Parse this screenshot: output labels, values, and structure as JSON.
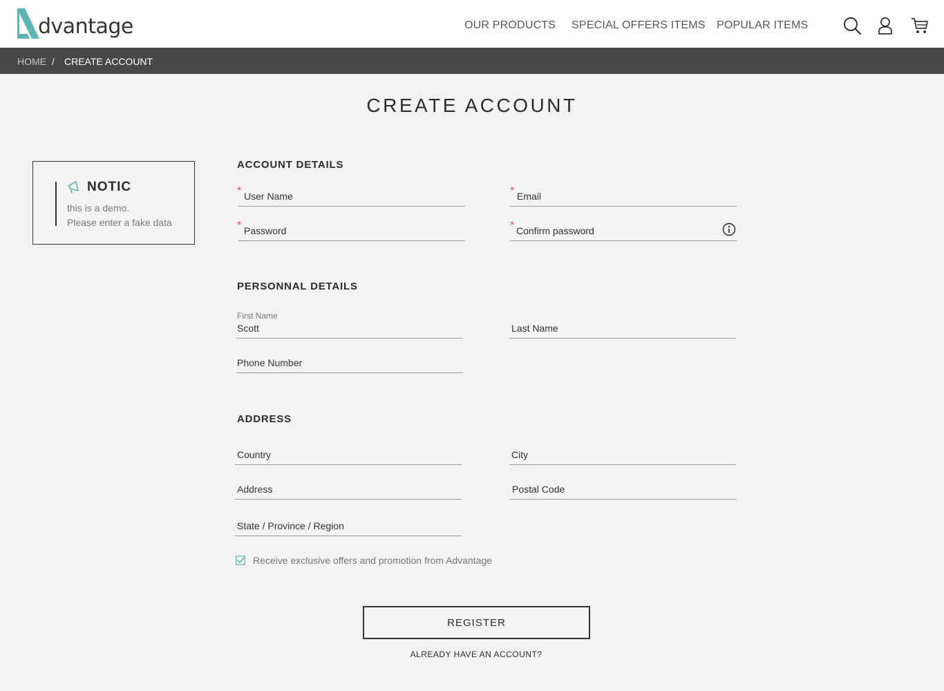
{
  "header": {
    "logo_text": "dvantage",
    "logo_letter": "A",
    "nav": [
      "OUR PRODUCTS",
      "SPECIAL OFFERS ITEMS",
      "POPULAR ITEMS"
    ],
    "icons": [
      "search-icon",
      "user-icon",
      "cart-icon"
    ]
  },
  "breadcrumb": {
    "home": "HOME",
    "separator": "/",
    "current": "CREATE ACCOUNT"
  },
  "page_title": "CREATE ACCOUNT",
  "notice": {
    "title": "NOTIC",
    "line1": "this is a demo.",
    "line2": "Please enter a fake data",
    "icon": "megaphone-icon"
  },
  "account_details": {
    "heading": "ACCOUNT DETAILS",
    "user_name": "User Name",
    "email": "Email",
    "password": "Password",
    "confirm_password": "Confirm password",
    "required_mark": "*"
  },
  "personal_details": {
    "heading": "PERSONNAL DETAILS",
    "first_name_label": "First Name",
    "first_name_value": "Scott",
    "last_name": "Last Name",
    "phone_number": "Phone Number"
  },
  "address": {
    "heading": "ADDRESS",
    "country": "Country",
    "city": "City",
    "address": "Address",
    "postal_code": "Postal Code",
    "state": "State / Province / Region"
  },
  "offers_checkbox": {
    "checked": true,
    "label": "Receive exclusive offers and promotion from Advantage"
  },
  "register_label": "REGISTER",
  "already_account": "ALREADY HAVE AN ACCOUNT?",
  "colors": {
    "accent": "#5fb5b5",
    "required": "#e14c6c",
    "bar": "#474747",
    "background": "#f3f3f3"
  }
}
